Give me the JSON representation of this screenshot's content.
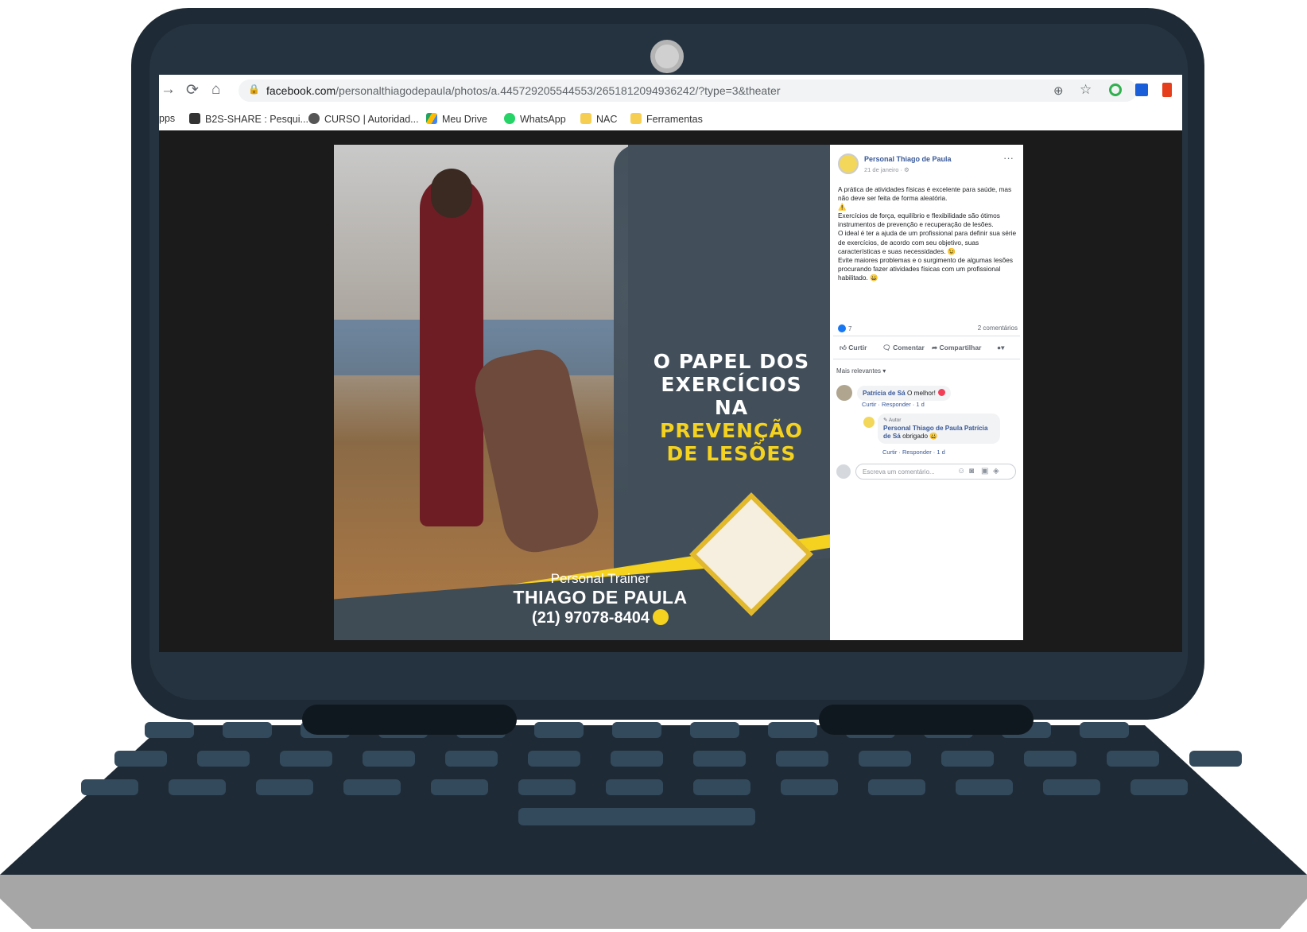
{
  "browser": {
    "url_host": "facebook.com",
    "url_path": "/personalthiagodepaula/photos/a.445729205544553/2651812094936242/?type=3&theater",
    "bookmarks": [
      {
        "label": "pps"
      },
      {
        "label": "B2S-SHARE : Pesqui..."
      },
      {
        "label": "CURSO | Autoridad..."
      },
      {
        "label": "Meu Drive"
      },
      {
        "label": "WhatsApp"
      },
      {
        "label": "NAC"
      },
      {
        "label": "Ferramentas"
      }
    ]
  },
  "photo": {
    "headline_line1": "O PAPEL DOS",
    "headline_line2": "EXERCÍCIOS",
    "headline_line3_a": "NA ",
    "headline_line3_b": "PREVENÇÃO",
    "headline_line4": "DE LESÕES",
    "brand_subtitle": "Personal Trainer",
    "brand_name": "THIAGO DE PAULA",
    "brand_phone": "(21) 97078-8404"
  },
  "post": {
    "page_name": "Personal Thiago de Paula",
    "date": "21 de janeiro · ⚙",
    "more": "···",
    "text": "A prática de atividades físicas é excelente para saúde, mas não deve ser feita de forma aleatória.\n⚠️\nExercícios de força, equilíbrio e flexibilidade são ótimos instrumentos de prevenção e recuperação de lesões.\nO ideal é ter a ajuda de um profissional para definir sua série de exercícios, de acordo com seu objetivo, suas características e suas necessidades. 😉\nEvite maiores problemas e o surgimento de algumas lesões procurando fazer atividades físicas com um profissional habilitado. 😀",
    "reaction_count": "7",
    "comments_count": "2 comentários",
    "actions": {
      "like": "Curtir",
      "comment": "Comentar",
      "share": "Compartilhar"
    },
    "sort_label": "Mais relevantes ▾",
    "comments": [
      {
        "author": "Patrícia de Sá",
        "text": "O melhor!",
        "meta": "Curtir · Responder · 1 d"
      },
      {
        "badge": "✎ Autor",
        "author": "Personal Thiago de Paula Patrícia de Sá",
        "text": "obrigado 😀",
        "meta": "Curtir · Responder · 1 d"
      }
    ],
    "write_placeholder": "Escreva um comentário..."
  },
  "colors": {
    "laptop_frame": "#1e2a35",
    "facebook_blue": "#385898",
    "accent_yellow": "#f4d21f"
  }
}
